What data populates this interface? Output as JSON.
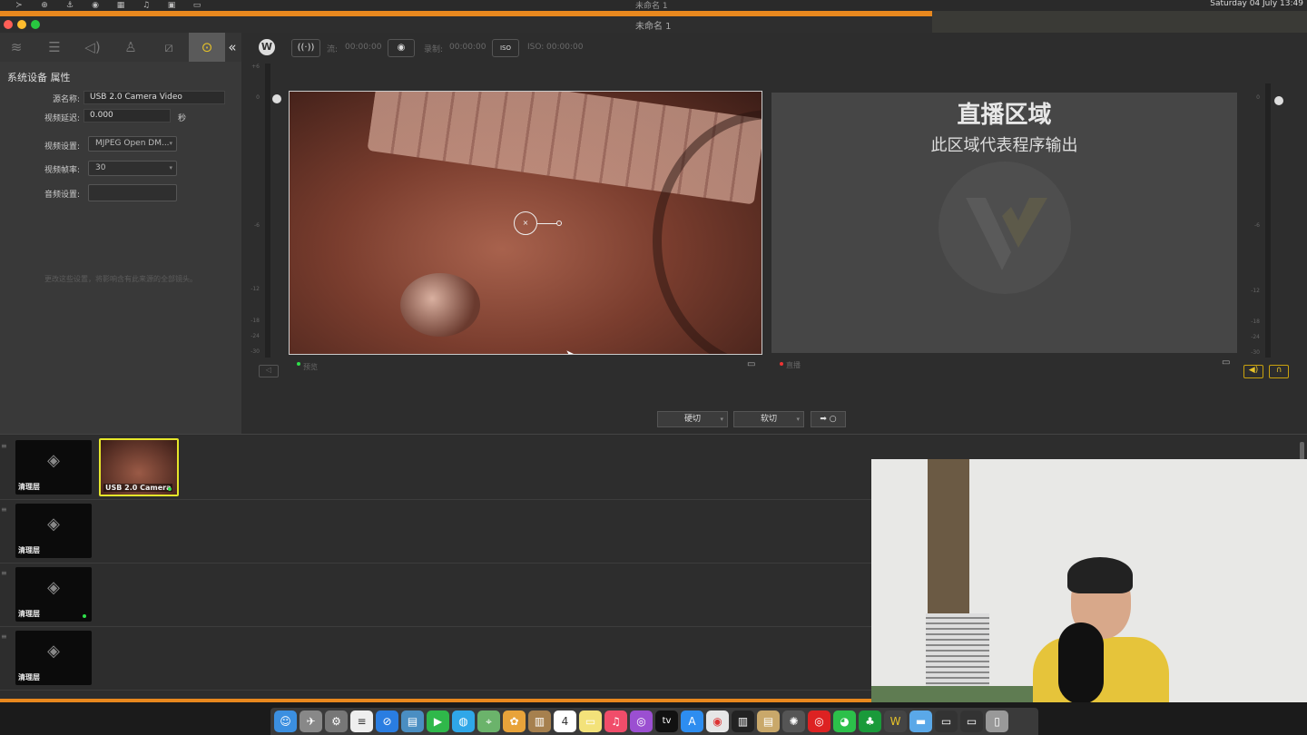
{
  "menubar": {
    "title": "未命名 1",
    "clock": "Saturday 04 July 13:49",
    "icons": [
      "terminal-icon",
      "globe-icon",
      "anchor-icon",
      "gamepad-icon",
      "grid-icon",
      "music-icon",
      "calendar-icon",
      "laptop-icon"
    ]
  },
  "window": {
    "title": "未命名 1"
  },
  "left_panel": {
    "tabs": [
      "layers-icon",
      "sliders-icon",
      "speaker-icon",
      "person-icon",
      "slash-icon",
      "more-icon",
      "collapse-icon"
    ],
    "title": "系统设备 属性",
    "source_name_label": "源名称:",
    "source_name_value": "USB 2.0 Camera Video",
    "video_delay_label": "视频延迟:",
    "video_delay_value": "0.000",
    "video_delay_unit": "秒",
    "video_settings_label": "视频设置:",
    "video_settings_value": "MJPEG Open DM...",
    "frame_rate_label": "视频帧率:",
    "frame_rate_value": "30",
    "audio_settings_label": "音频设置:",
    "audio_settings_value": "",
    "hint": "更改这些设置，将影响含有此来源的全部镜头。"
  },
  "toolbar": {
    "stream_label": "流:",
    "stream_time": "00:00:00",
    "record_label": "录制:",
    "record_time": "00:00:00",
    "iso_badge": "ISO",
    "iso_label": "ISO:",
    "iso_time": "00:00:00"
  },
  "preview": {
    "label": "预览"
  },
  "program": {
    "label": "直播",
    "title": "直播区域",
    "subtitle": "此区域代表程序输出"
  },
  "transitions": {
    "hard_cut": "硬切",
    "soft_cut": "软切",
    "go_label": "○"
  },
  "meter_scale_left": [
    "+6",
    "0",
    "-6",
    "-12",
    "-18",
    "-24",
    "-30"
  ],
  "meter_scale_right": [
    "0",
    "-6",
    "-12",
    "-18",
    "-24",
    "-30"
  ],
  "shots": [
    {
      "label": "清理层"
    },
    {
      "label": "USB 2.0 Camera"
    },
    {
      "label": "清理层"
    },
    {
      "label": "清理层"
    },
    {
      "label": "清理层"
    }
  ],
  "dock": {
    "icons": [
      "finder-icon",
      "launchpad-icon",
      "system-preferences-icon",
      "notes-icon",
      "safari-icon",
      "preview-icon",
      "facetime-icon",
      "messages-icon",
      "maps-icon",
      "photos-icon",
      "contacts-icon",
      "calendar-icon",
      "stickies-icon",
      "music-icon",
      "podcasts-icon",
      "tv-icon",
      "appstore-icon",
      "chrome-icon",
      "piano-icon",
      "archive-icon",
      "davinci-icon",
      "netease-icon",
      "wechat-icon",
      "evernote-icon",
      "wirecast-icon",
      "folder-icon",
      "screen-icon",
      "screen2-icon",
      "trash-icon"
    ],
    "calendar_day": "4",
    "tv_label": "tv"
  }
}
